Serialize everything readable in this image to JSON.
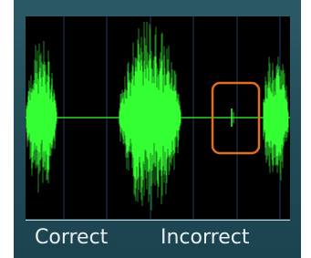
{
  "colors": {
    "frame_background": "#25505c",
    "waveform_background": "#000000",
    "waveform_bright": "#33ff33",
    "waveform_dark": "#1f8a1f",
    "gridline": "#243a63",
    "highlight_box": "#e0701e",
    "label_text": "#e6eef0"
  },
  "labels": {
    "correct": "Correct",
    "incorrect": "Incorrect"
  },
  "highlight": {
    "icon": "rounded-rectangle-outline"
  }
}
